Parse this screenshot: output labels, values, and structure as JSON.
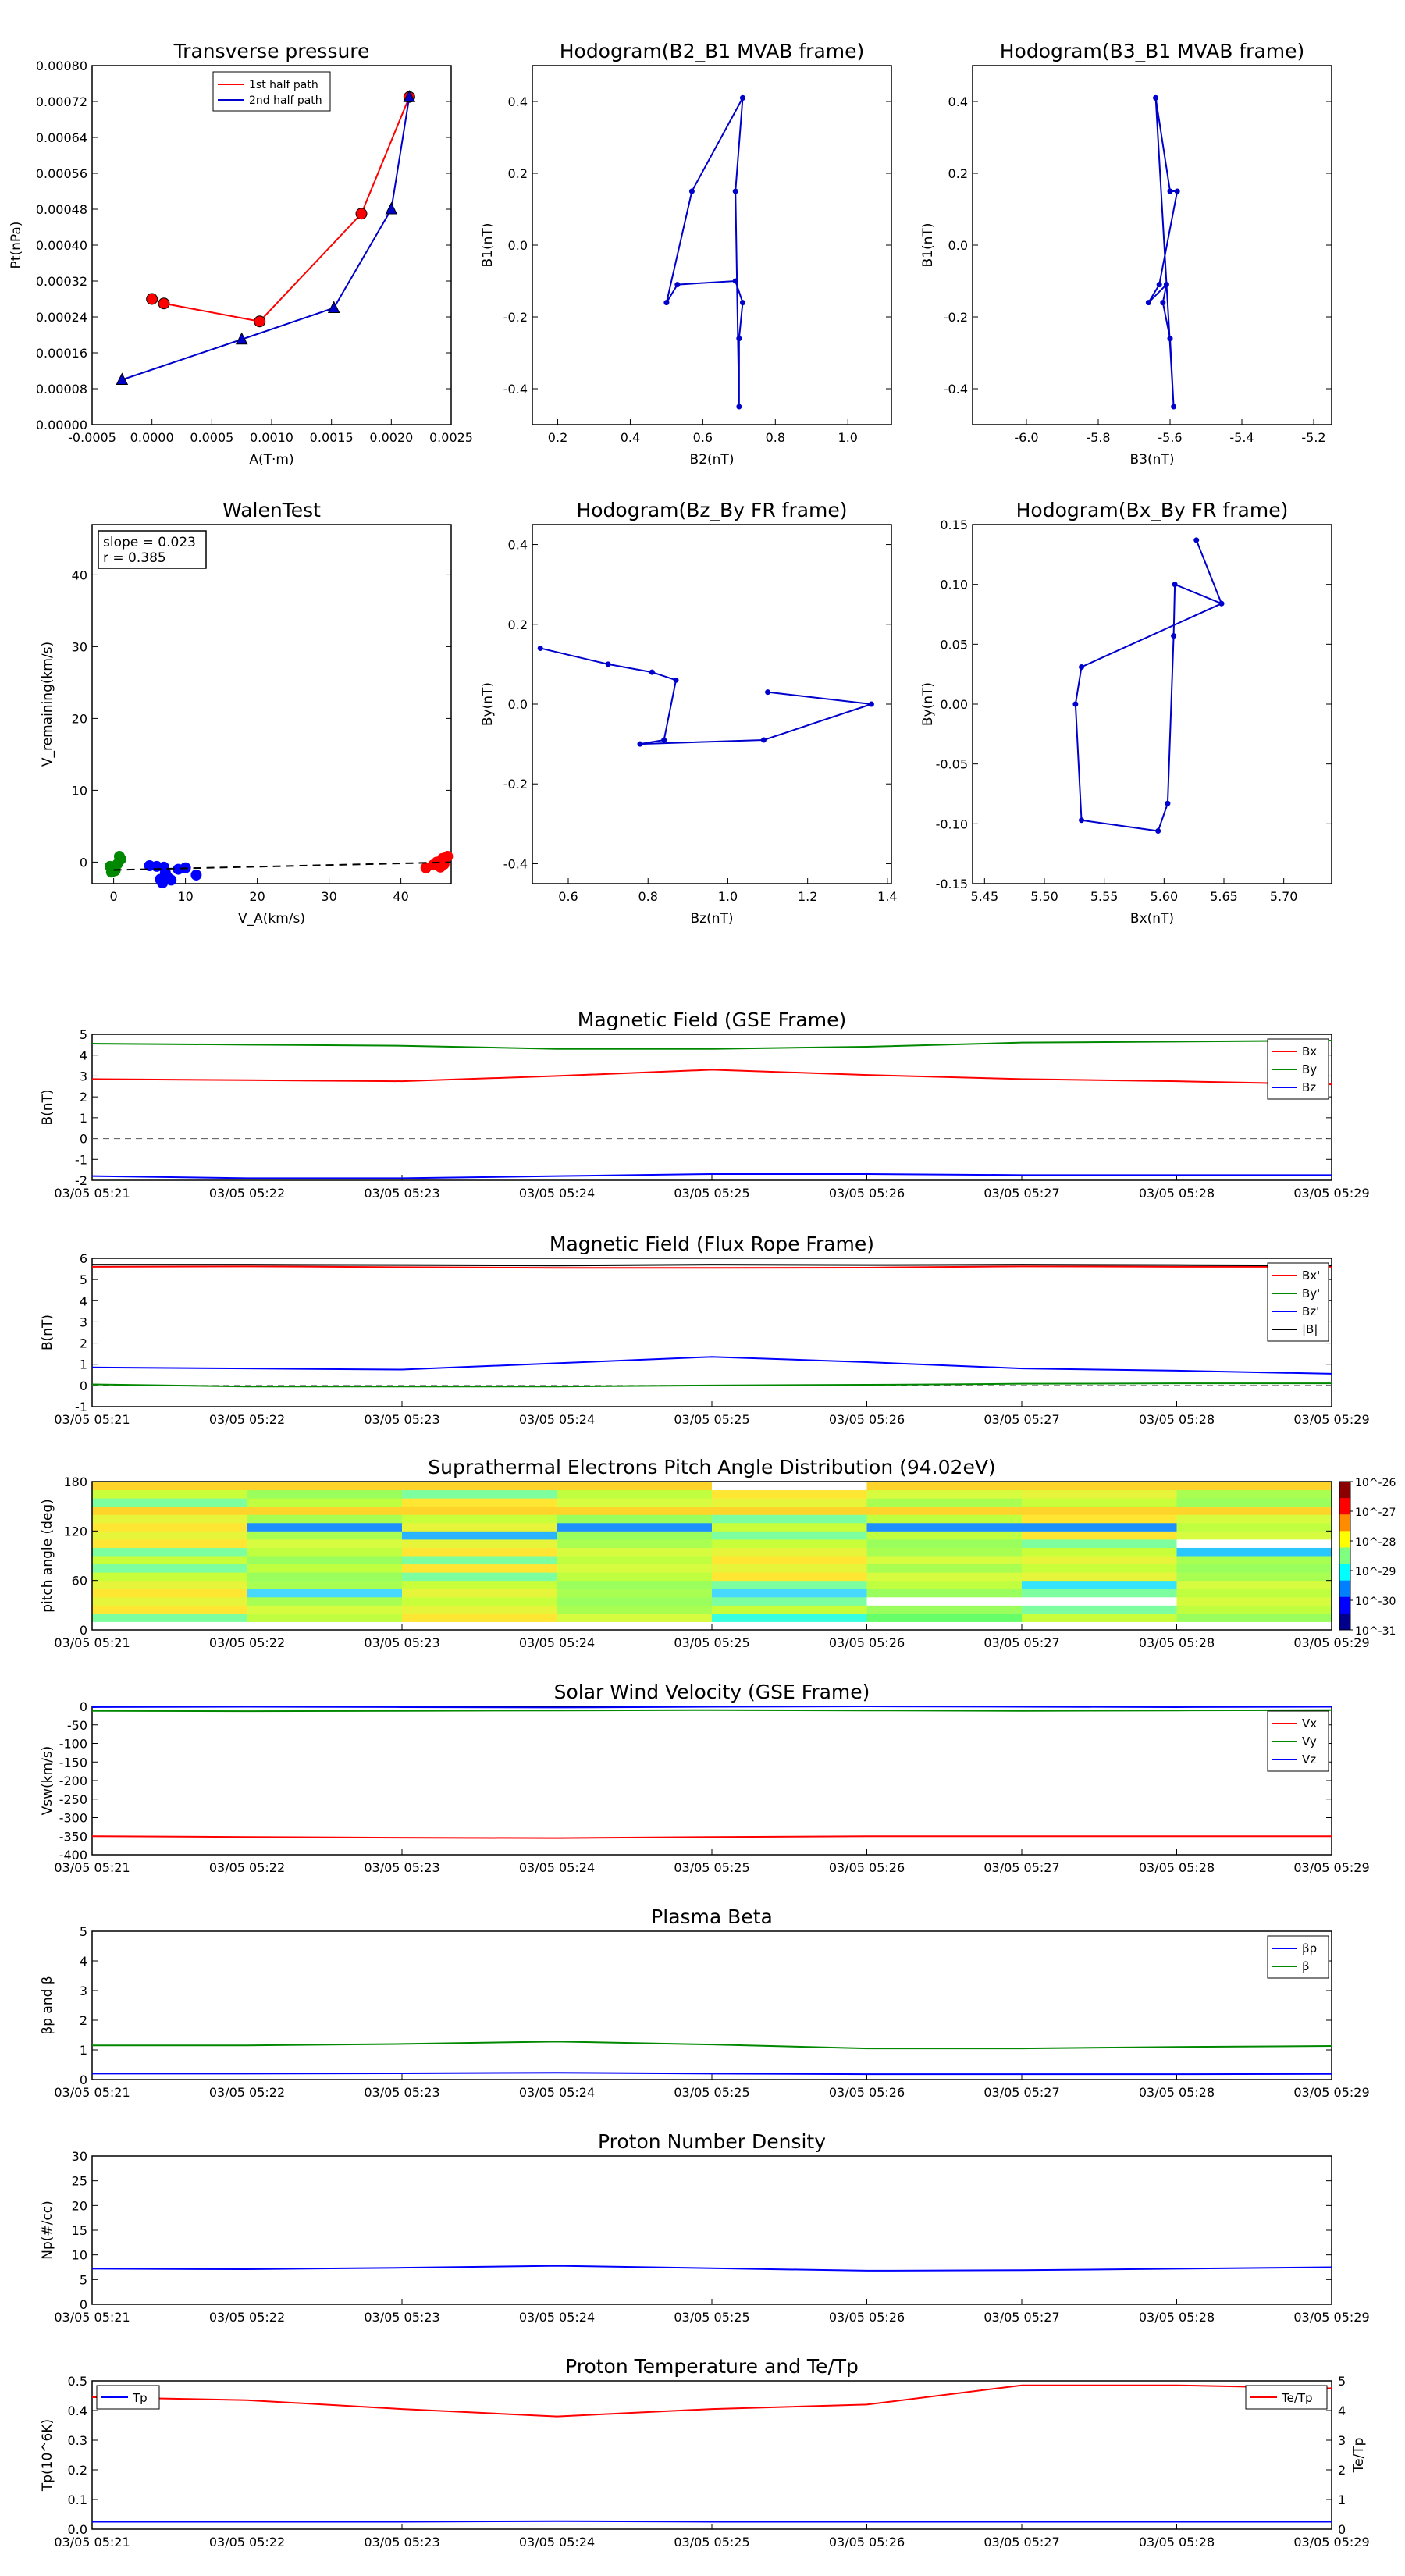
{
  "figure": {
    "time_ticks": [
      "03/05 05:21",
      "03/05 05:22",
      "03/05 05:23",
      "03/05 05:24",
      "03/05 05:25",
      "03/05 05:26",
      "03/05 05:27",
      "03/05 05:28",
      "03/05 05:29"
    ]
  },
  "chart_data": [
    {
      "id": "transverse_pressure",
      "type": "line",
      "title": "Transverse pressure",
      "xlabel": "A(T·m)",
      "ylabel": "Pt(nPa)",
      "xlim": [
        -0.0005,
        0.0025
      ],
      "ylim": [
        0,
        0.0008
      ],
      "xticks": [
        "-0.0005",
        "0.0000",
        "0.0005",
        "0.0010",
        "0.0015",
        "0.0020",
        "0.0025"
      ],
      "yticks": [
        "0.00000",
        "0.00008",
        "0.00016",
        "0.00024",
        "0.00032",
        "0.00040",
        "0.00048",
        "0.00056",
        "0.00064",
        "0.00072",
        "0.00080"
      ],
      "legend": "top-center",
      "series": [
        {
          "name": "1st half path",
          "color": "#ff0000",
          "marker": "circle",
          "x": [
            0.00215,
            0.00175,
            0.0009,
            0.0001,
            0.0
          ],
          "y": [
            0.00073,
            0.00047,
            0.00023,
            0.00027,
            0.00028
          ]
        },
        {
          "name": "2nd half path",
          "color": "#0000cc",
          "marker": "triangle",
          "x": [
            0.00215,
            0.002,
            0.00152,
            0.00075,
            -0.00025
          ],
          "y": [
            0.00073,
            0.00048,
            0.00026,
            0.00019,
            0.0001
          ]
        }
      ]
    },
    {
      "id": "hodogram_b2_b1",
      "type": "line",
      "title": "Hodogram(B2_B1 MVAB frame)",
      "xlabel": "B2(nT)",
      "ylabel": "B1(nT)",
      "xlim": [
        0.13,
        1.12
      ],
      "ylim": [
        -0.5,
        0.5
      ],
      "xticks": [
        "0.2",
        "0.4",
        "0.6",
        "0.8",
        "1.0"
      ],
      "yticks": [
        "-0.4",
        "-0.2",
        "0.0",
        "0.2",
        "0.4"
      ],
      "series": [
        {
          "name": "",
          "color": "#0000cc",
          "x": [
            0.71,
            0.57,
            0.5,
            0.53,
            0.69,
            0.71,
            0.7,
            0.7,
            0.69,
            0.71
          ],
          "y": [
            0.41,
            0.15,
            -0.16,
            -0.11,
            -0.1,
            -0.16,
            -0.26,
            -0.45,
            0.15,
            0.41
          ]
        }
      ]
    },
    {
      "id": "hodogram_b3_b1",
      "type": "line",
      "title": "Hodogram(B3_B1 MVAB frame)",
      "xlabel": "B3(nT)",
      "ylabel": "B1(nT)",
      "xlim": [
        -6.15,
        -5.15
      ],
      "ylim": [
        -0.5,
        0.5
      ],
      "xticks": [
        "-6.0",
        "-5.8",
        "-5.6",
        "-5.4",
        "-5.2"
      ],
      "yticks": [
        "-0.4",
        "-0.2",
        "0.0",
        "0.2",
        "0.4"
      ],
      "series": [
        {
          "name": "",
          "color": "#0000cc",
          "x": [
            -5.64,
            -5.6,
            -5.58,
            -5.63,
            -5.66,
            -5.61,
            -5.62,
            -5.6,
            -5.59,
            -5.64
          ],
          "y": [
            0.41,
            0.15,
            0.15,
            -0.11,
            -0.16,
            -0.11,
            -0.16,
            -0.26,
            -0.45,
            0.41
          ]
        }
      ]
    },
    {
      "id": "walen_test",
      "type": "scatter",
      "title": "WalenTest",
      "xlabel": "V_A(km/s)",
      "ylabel": "V_remaining(km/s)",
      "xlim": [
        -3,
        47
      ],
      "ylim": [
        -3,
        47
      ],
      "xticks": [
        "0",
        "10",
        "20",
        "30",
        "40"
      ],
      "yticks": [
        "0",
        "10",
        "20",
        "30",
        "40"
      ],
      "annotations": [
        "slope = 0.023",
        "r = 0.385"
      ],
      "fit": {
        "slope": 0.023,
        "intercept": -1.1
      },
      "series": [
        {
          "name": "",
          "color": "#008800",
          "x": [
            -0.5,
            0.2,
            0.8,
            -0.3,
            0.5,
            1.0,
            0.0
          ],
          "y": [
            -0.6,
            -1.2,
            0.8,
            -1.4,
            -0.3,
            0.4,
            -0.9
          ]
        },
        {
          "name": "",
          "color": "#0000ff",
          "x": [
            5,
            6,
            7,
            6.5,
            7.5,
            9,
            10,
            11.5,
            8,
            6.8,
            7.2
          ],
          "y": [
            -0.5,
            -0.6,
            -0.7,
            -2.4,
            -2.1,
            -1.0,
            -0.8,
            -1.8,
            -2.5,
            -2.9,
            -1.5
          ]
        },
        {
          "name": "",
          "color": "#ff0000",
          "x": [
            43.5,
            44.5,
            45,
            45.8,
            46.5,
            46,
            45.5
          ],
          "y": [
            -0.8,
            -0.4,
            0.0,
            0.5,
            0.8,
            -0.3,
            -0.7
          ]
        }
      ]
    },
    {
      "id": "hodogram_bz_by",
      "type": "line",
      "title": "Hodogram(Bz_By FR frame)",
      "xlabel": "Bz(nT)",
      "ylabel": "By(nT)",
      "xlim": [
        0.51,
        1.41
      ],
      "ylim": [
        -0.45,
        0.45
      ],
      "xticks": [
        "0.6",
        "0.8",
        "1.0",
        "1.2",
        "1.4"
      ],
      "yticks": [
        "-0.4",
        "-0.2",
        "0.0",
        "0.2",
        "0.4"
      ],
      "series": [
        {
          "name": "",
          "color": "#0000cc",
          "x": [
            0.53,
            0.7,
            0.81,
            0.87,
            0.84,
            0.78,
            1.09,
            1.36,
            1.1
          ],
          "y": [
            0.14,
            0.1,
            0.08,
            0.06,
            -0.09,
            -0.1,
            -0.09,
            0.0,
            0.03
          ]
        }
      ]
    },
    {
      "id": "hodogram_bx_by",
      "type": "line",
      "title": "Hodogram(Bx_By FR frame)",
      "xlabel": "Bx(nT)",
      "ylabel": "By(nT)",
      "xlim": [
        5.44,
        5.74
      ],
      "ylim": [
        -0.15,
        0.15
      ],
      "xticks": [
        "5.45",
        "5.50",
        "5.55",
        "5.60",
        "5.65",
        "5.70"
      ],
      "yticks": [
        "-0.15",
        "-0.10",
        "-0.05",
        "0.00",
        "0.05",
        "0.10",
        "0.15"
      ],
      "series": [
        {
          "name": "",
          "color": "#0000cc",
          "x": [
            5.627,
            5.648,
            5.609,
            5.608,
            5.603,
            5.595,
            5.531,
            5.526,
            5.531,
            5.648
          ],
          "y": [
            0.137,
            0.084,
            0.1,
            0.057,
            -0.083,
            -0.106,
            -0.097,
            0.0,
            0.031,
            0.084
          ]
        }
      ]
    },
    {
      "id": "mag_gse",
      "type": "line",
      "title": "Magnetic Field (GSE Frame)",
      "xlabel": "",
      "ylabel": "B(nT)",
      "ylim": [
        -2,
        5
      ],
      "yticks": [
        "-2",
        "-1",
        "0",
        "1",
        "2",
        "3",
        "4",
        "5"
      ],
      "legend": "top-right",
      "series": [
        {
          "name": "Bx",
          "color": "#ff0000",
          "values": [
            2.85,
            2.8,
            2.75,
            3.0,
            3.3,
            3.05,
            2.85,
            2.75,
            2.6
          ]
        },
        {
          "name": "By",
          "color": "#008800",
          "values": [
            4.55,
            4.5,
            4.45,
            4.3,
            4.3,
            4.4,
            4.6,
            4.65,
            4.7
          ]
        },
        {
          "name": "Bz",
          "color": "#0000ff",
          "values": [
            -1.8,
            -1.9,
            -1.9,
            -1.8,
            -1.7,
            -1.7,
            -1.75,
            -1.75,
            -1.75
          ]
        }
      ]
    },
    {
      "id": "mag_fr",
      "type": "line",
      "title": "Magnetic Field (Flux Rope Frame)",
      "xlabel": "",
      "ylabel": "B(nT)",
      "ylim": [
        -1,
        6
      ],
      "yticks": [
        "-1",
        "0",
        "1",
        "2",
        "3",
        "4",
        "5",
        "6"
      ],
      "legend": "top-right",
      "series": [
        {
          "name": "Bx'",
          "color": "#ff0000",
          "values": [
            5.6,
            5.62,
            5.58,
            5.55,
            5.55,
            5.56,
            5.62,
            5.6,
            5.6
          ]
        },
        {
          "name": "By'",
          "color": "#008800",
          "values": [
            0.05,
            -0.05,
            -0.05,
            -0.05,
            0.0,
            0.03,
            0.08,
            0.1,
            0.1
          ]
        },
        {
          "name": "Bz'",
          "color": "#0000ff",
          "values": [
            0.85,
            0.8,
            0.75,
            1.05,
            1.35,
            1.1,
            0.8,
            0.7,
            0.55
          ]
        },
        {
          "name": "|B|",
          "color": "#000000",
          "values": [
            5.7,
            5.7,
            5.68,
            5.66,
            5.7,
            5.68,
            5.7,
            5.68,
            5.66
          ]
        }
      ]
    },
    {
      "id": "pad",
      "type": "heatmap",
      "title": "Suprathermal Electrons Pitch Angle Distribution (94.02eV)",
      "xlabel": "",
      "ylabel": "pitch angle (deg)",
      "ylim": [
        0,
        180
      ],
      "yticks": [
        "0",
        "60",
        "120",
        "180"
      ],
      "colorbar_ticks": [
        "10^-26",
        "10^-27",
        "10^-28",
        "10^-29",
        "10^-30",
        "10^-31"
      ]
    },
    {
      "id": "velocity",
      "type": "line",
      "title": "Solar Wind Velocity (GSE Frame)",
      "xlabel": "",
      "ylabel": "Vsw(km/s)",
      "ylim": [
        -400,
        0
      ],
      "yticks": [
        "-400",
        "-350",
        "-300",
        "-250",
        "-200",
        "-150",
        "-100",
        "-50",
        "0"
      ],
      "legend": "top-right",
      "series": [
        {
          "name": "Vx",
          "color": "#ff0000",
          "values": [
            -350,
            -352,
            -354,
            -355,
            -352,
            -350,
            -350,
            -350,
            -350
          ]
        },
        {
          "name": "Vy",
          "color": "#008800",
          "values": [
            -12,
            -13,
            -12,
            -11,
            -10,
            -11,
            -12,
            -11,
            -10
          ]
        },
        {
          "name": "Vz",
          "color": "#0000ff",
          "values": [
            -2,
            -1,
            -2,
            -3,
            -1,
            0,
            -1,
            -2,
            -1
          ]
        }
      ]
    },
    {
      "id": "beta",
      "type": "line",
      "title": "Plasma Beta",
      "xlabel": "",
      "ylabel": "βp and β",
      "ylim": [
        0,
        5
      ],
      "yticks": [
        "0",
        "1",
        "2",
        "3",
        "4",
        "5"
      ],
      "legend": "top-right",
      "series": [
        {
          "name": "βp",
          "color": "#0000ff",
          "values": [
            0.2,
            0.2,
            0.21,
            0.23,
            0.2,
            0.18,
            0.18,
            0.18,
            0.19
          ]
        },
        {
          "name": "β",
          "color": "#008800",
          "values": [
            1.15,
            1.15,
            1.2,
            1.28,
            1.18,
            1.05,
            1.05,
            1.1,
            1.13
          ]
        }
      ]
    },
    {
      "id": "density",
      "type": "line",
      "title": "Proton Number Density",
      "xlabel": "",
      "ylabel": "Np(#/cc)",
      "ylim": [
        0,
        30
      ],
      "yticks": [
        "0",
        "5",
        "10",
        "15",
        "20",
        "25",
        "30"
      ],
      "series": [
        {
          "name": "",
          "color": "#0000ff",
          "values": [
            7.2,
            7.1,
            7.4,
            7.8,
            7.3,
            6.8,
            6.9,
            7.2,
            7.5
          ]
        }
      ]
    },
    {
      "id": "temperature",
      "type": "line",
      "title": "Proton Temperature and Te/Tp",
      "xlabel": "",
      "ylabel": "Tp(10^6K)",
      "ylabel_right": "Te/Tp",
      "ylim": [
        0,
        0.5
      ],
      "ylim_right": [
        0,
        5
      ],
      "yticks": [
        "0.0",
        "0.1",
        "0.2",
        "0.3",
        "0.4",
        "0.5"
      ],
      "yticks_right": [
        "0",
        "1",
        "2",
        "3",
        "4",
        "5"
      ],
      "legend_left": "Tp",
      "legend_right": "Te/Tp",
      "series": [
        {
          "name": "Tp",
          "color": "#0000ff",
          "axis": "left",
          "values": [
            0.025,
            0.025,
            0.025,
            0.027,
            0.025,
            0.025,
            0.025,
            0.025,
            0.025
          ]
        },
        {
          "name": "Te/Tp",
          "color": "#ff0000",
          "axis": "right",
          "values": [
            4.45,
            4.35,
            4.05,
            3.8,
            4.05,
            4.2,
            4.85,
            4.85,
            4.75
          ]
        }
      ]
    }
  ]
}
